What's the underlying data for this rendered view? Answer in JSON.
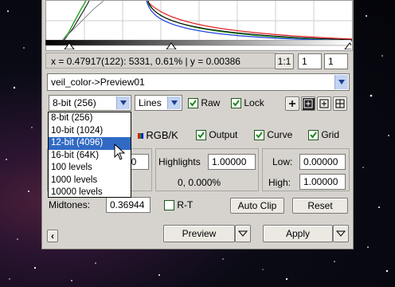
{
  "readout": {
    "text": "x = 0.47917(122): 5331, 0.61% | y = 0.00386"
  },
  "zoom": {
    "ratio_label": "1:1",
    "field_a": "1",
    "field_b": "1"
  },
  "view_select": {
    "value": "veil_color->Preview01"
  },
  "bit_select": {
    "value": "8-bit (256)",
    "options": [
      "8-bit (256)",
      "10-bit (1024)",
      "12-bit (4096)",
      "16-bit (64K)",
      "100 levels",
      "1000 levels",
      "10000 levels"
    ],
    "highlighted_index": 2
  },
  "mode_select": {
    "value": "Lines"
  },
  "checks": {
    "raw": "Raw",
    "lock": "Lock",
    "output": "Output",
    "curve": "Curve",
    "grid": "Grid"
  },
  "channel": {
    "label": "RGB/K"
  },
  "shadows": {
    "value": "50"
  },
  "highlights": {
    "label": "Highlights",
    "value": "1.00000",
    "stat": "0,  0.000%"
  },
  "range": {
    "low_label": "Low:",
    "low_value": "0.00000",
    "high_label": "High:",
    "high_value": "1.00000"
  },
  "midtones": {
    "label": "Midtones:",
    "value": "0.36944"
  },
  "rt": {
    "label": "R-T"
  },
  "buttons": {
    "auto_clip": "Auto Clip",
    "reset": "Reset",
    "preview": "Preview",
    "apply": "Apply"
  },
  "colors": {
    "accent": "#316ac5",
    "check": "#1d8a1d",
    "panel": "#d6d3ce"
  }
}
